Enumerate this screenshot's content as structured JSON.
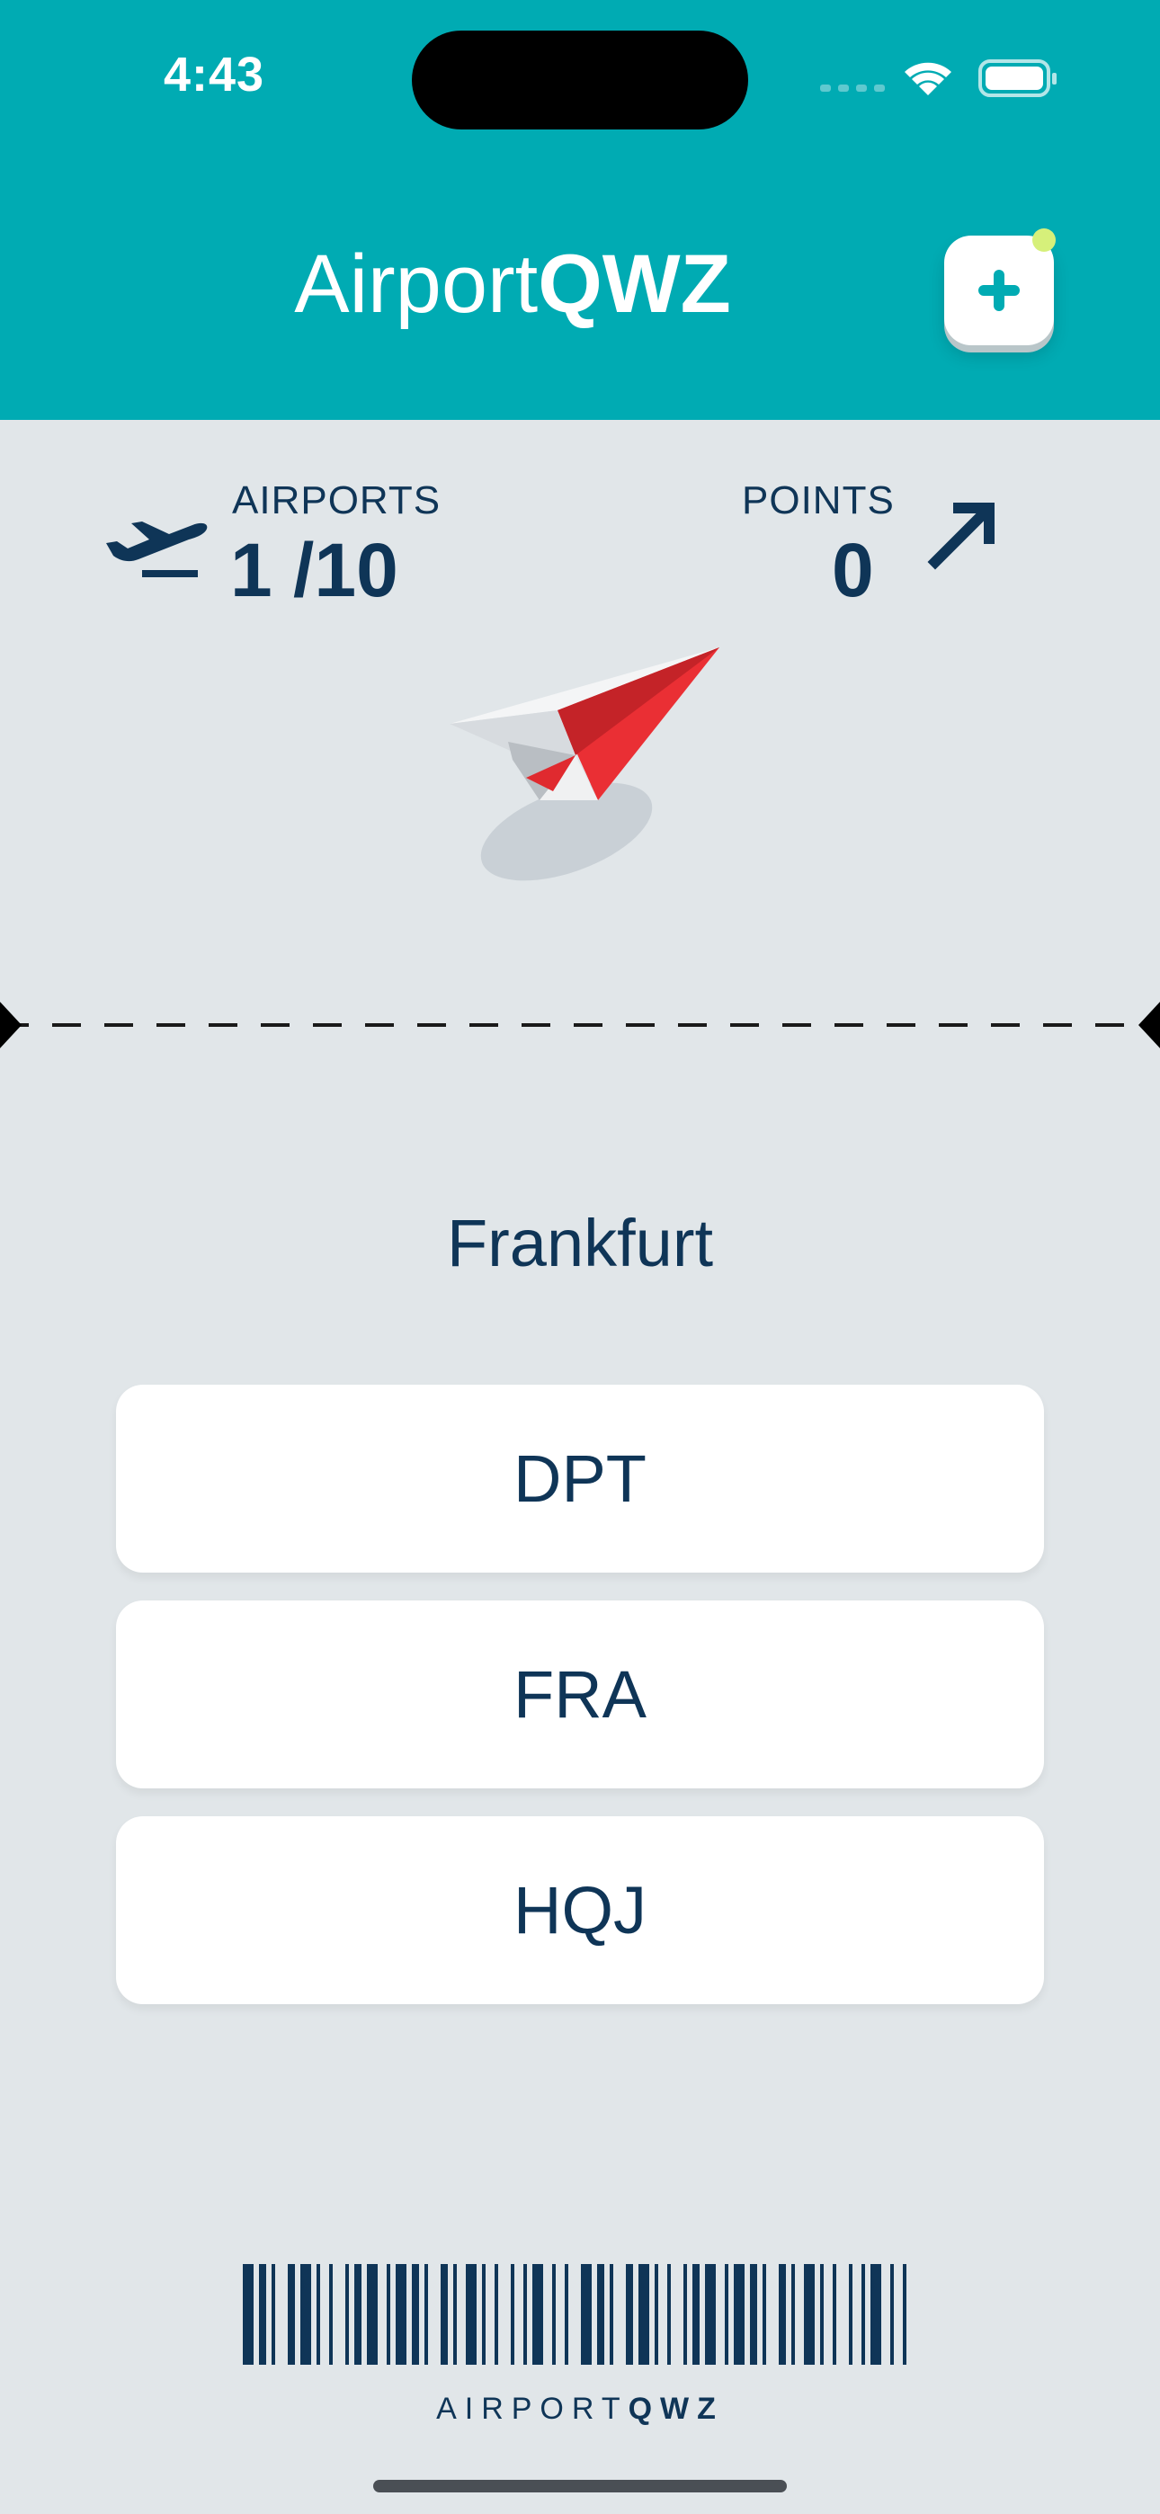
{
  "status_bar": {
    "time": "4:43"
  },
  "header": {
    "title_light": "Airport",
    "title_bold": "QWZ"
  },
  "stats": {
    "airports_label": "AIRPORTS",
    "airports_value": "1 /10",
    "points_label": "POINTS",
    "points_value": "0"
  },
  "question": {
    "city": "Frankfurt"
  },
  "options": [
    "DPT",
    "FRA",
    "HQJ"
  ],
  "footer": {
    "caption_light": "AIRPORT",
    "caption_bold": "QWZ"
  },
  "colors": {
    "header": "#00abb3",
    "text": "#0f3557",
    "background": "#e1e6e9",
    "plane": "#ea2f34"
  }
}
